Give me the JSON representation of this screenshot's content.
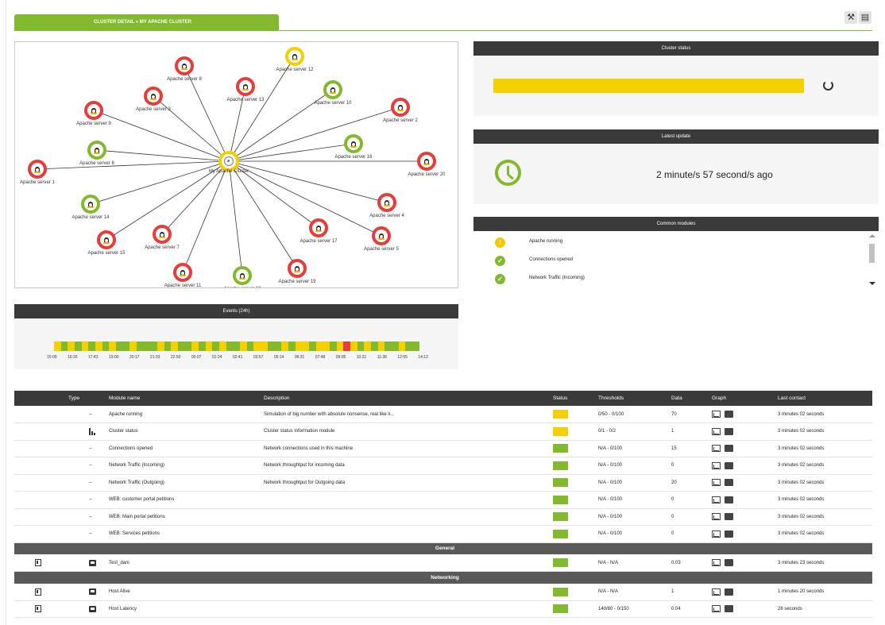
{
  "header": {
    "tab_title": "CLUSTER DETAIL » MY APACHE CLUSTER",
    "tools_icon": "tools-icon",
    "list_icon": "list-icon"
  },
  "map": {
    "center": {
      "label": "My Apache Cluster",
      "status": "yellow"
    },
    "nodes": [
      {
        "label": "Apache server 8",
        "status": "red"
      },
      {
        "label": "Apache server 12",
        "status": "yellow"
      },
      {
        "label": "Apache server 3",
        "status": "red"
      },
      {
        "label": "Apache server 13",
        "status": "red"
      },
      {
        "label": "Apache server 10",
        "status": "green"
      },
      {
        "label": "Apache server 9",
        "status": "red"
      },
      {
        "label": "Apache server 2",
        "status": "red"
      },
      {
        "label": "Apache server 6",
        "status": "green"
      },
      {
        "label": "Apache server 16",
        "status": "green"
      },
      {
        "label": "Apache server 1",
        "status": "red"
      },
      {
        "label": "Apache server 20",
        "status": "red"
      },
      {
        "label": "Apache server 14",
        "status": "green"
      },
      {
        "label": "Apache server 4",
        "status": "red"
      },
      {
        "label": "Apache server 15",
        "status": "red"
      },
      {
        "label": "Apache server 7",
        "status": "red"
      },
      {
        "label": "Apache server 17",
        "status": "red"
      },
      {
        "label": "Apache server 5",
        "status": "red"
      },
      {
        "label": "Apache server 11",
        "status": "red"
      },
      {
        "label": "Apache server 18",
        "status": "green"
      },
      {
        "label": "Apache server 19",
        "status": "red"
      }
    ]
  },
  "cluster_status": {
    "title": "Cluster status",
    "bar_color": "#f5d000"
  },
  "latest_update": {
    "title": "Latest update",
    "text": "2 minute/s 57 second/s ago"
  },
  "common_modules": {
    "title": "Common modules",
    "items": [
      {
        "label": "Apache running",
        "state": "warn",
        "icon": "!"
      },
      {
        "label": "Connections opened",
        "state": "ok",
        "icon": "✓"
      },
      {
        "label": "Network Traffic (Incoming)",
        "state": "ok",
        "icon": "✓"
      }
    ]
  },
  "events": {
    "title": "Events (24h)",
    "segments": [
      "y",
      "g",
      "y",
      "g",
      "y",
      "g",
      "y",
      "g",
      "y",
      "g",
      "g",
      "y",
      "g",
      "g",
      "g",
      "y",
      "g",
      "y",
      "g",
      "g",
      "y",
      "g",
      "y",
      "g",
      "y",
      "g",
      "g",
      "y",
      "g",
      "y",
      "y",
      "g",
      "g",
      "y",
      "g",
      "y",
      "y",
      "g",
      "y",
      "y",
      "g",
      "y",
      "r",
      "y",
      "g",
      "y",
      "g",
      "y",
      "g",
      "g",
      "y",
      "g",
      "g"
    ],
    "colors": {
      "g": "#82b92e",
      "y": "#f5d000",
      "r": "#e63c3c"
    },
    "ticks": [
      "15:09",
      "16:26",
      "17:43",
      "19:00",
      "20:17",
      "21:33",
      "22:50",
      "00:07",
      "01:24",
      "02:41",
      "03:57",
      "05:14",
      "06:31",
      "07:48",
      "09:05",
      "10:21",
      "11:38",
      "12:55",
      "14:12"
    ]
  },
  "table": {
    "headers": [
      "",
      "Type",
      "Module name",
      "Description",
      "Status",
      "Thresholds",
      "Data",
      "Graph",
      "Last contact"
    ],
    "rows": [
      {
        "kind": "row",
        "c0": "",
        "type": "--",
        "name": "Apache running",
        "desc": "Simulation of big number with absolute nonsense, real like li...",
        "status": "yellow",
        "thr": "0/50 - 0/100",
        "data": "70",
        "last": "3 minutes 02 seconds"
      },
      {
        "kind": "row",
        "c0": "",
        "type": "bar",
        "name": "Cluster status",
        "desc": "Cluster status information module",
        "status": "yellow",
        "thr": "0/1 - 0/2",
        "data": "1",
        "last": "3 minutes 02 seconds"
      },
      {
        "kind": "row",
        "c0": "",
        "type": "--",
        "name": "Connections opened",
        "desc": "Network connections used in this machine",
        "status": "green",
        "thr": "N/A - 0/100",
        "data": "15",
        "last": "3 minutes 02 seconds"
      },
      {
        "kind": "row",
        "c0": "",
        "type": "--",
        "name": "Network Traffic (Incoming)",
        "desc": "Network throughtput for incoming data",
        "status": "green",
        "thr": "N/A - 0/100",
        "data": "0",
        "last": "3 minutes 02 seconds"
      },
      {
        "kind": "row",
        "c0": "",
        "type": "--",
        "name": "Network Traffic (Outgoing)",
        "desc": "Network throughtput for Outgoing data",
        "status": "green",
        "thr": "N/A - 0/100",
        "data": "20",
        "last": "3 minutes 02 seconds"
      },
      {
        "kind": "row",
        "c0": "",
        "type": "--",
        "name": "WEB: customer portal petitions",
        "desc": "",
        "status": "green",
        "thr": "N/A - 0/100",
        "data": "0",
        "last": "3 minutes 02 seconds"
      },
      {
        "kind": "row",
        "c0": "",
        "type": "--",
        "name": "WEB: Main portal petitions",
        "desc": "",
        "status": "green",
        "thr": "N/A - 0/100",
        "data": "0",
        "last": "3 minutes 02 seconds"
      },
      {
        "kind": "row",
        "c0": "",
        "type": "--",
        "name": "WEB: Services petitions",
        "desc": "",
        "status": "green",
        "thr": "N/A - 0/100",
        "data": "0",
        "last": "3 minutes 02 seconds"
      },
      {
        "kind": "group",
        "label": "General"
      },
      {
        "kind": "row",
        "c0": "door",
        "type": "mon",
        "name": "Test_dani",
        "desc": "",
        "status": "green",
        "thr": "N/A - N/A",
        "data": "0.03",
        "last": "3 minutes 23 seconds"
      },
      {
        "kind": "group",
        "label": "Networking"
      },
      {
        "kind": "row",
        "c0": "door",
        "type": "mon",
        "name": "Host Alive",
        "desc": "",
        "status": "green",
        "thr": "N/A - N/A",
        "data": "1",
        "last": "1 minutes 20 seconds"
      },
      {
        "kind": "row",
        "c0": "door",
        "type": "mon",
        "name": "Host Latency",
        "desc": "",
        "status": "green",
        "thr": "140/80 - 0/150",
        "data": "0.04",
        "last": "28 seconds"
      }
    ]
  }
}
